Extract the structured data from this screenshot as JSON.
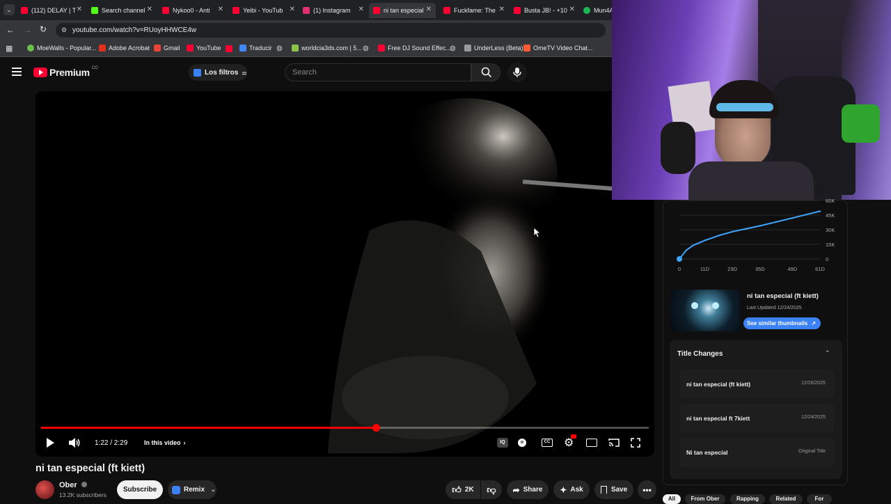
{
  "tabs": [
    {
      "label": "(112) DELAY | T",
      "color": "#ff0033"
    },
    {
      "label": "Search channel",
      "color": "#53fc18"
    },
    {
      "label": "Nykoo0 - Anti",
      "color": "#ff0033"
    },
    {
      "label": "Yeibi - YouTub",
      "color": "#ff0033"
    },
    {
      "label": "(1) Instagram",
      "color": "#e1306c"
    },
    {
      "label": "ni tan especial",
      "color": "#ff0033"
    },
    {
      "label": "Fuckfame: The",
      "color": "#ff0033"
    },
    {
      "label": "Busta JB! - +10",
      "color": "#ff0033"
    },
    {
      "label": "Mun4A",
      "color": "#1db954"
    }
  ],
  "address": {
    "url": "youtube.com/watch?v=RUoyHHWCE4w"
  },
  "bookmarks": [
    {
      "label": "MoeWalls - Popular...",
      "color": "#6abf4b"
    },
    {
      "label": "Adobe Acrobat",
      "color": "#e0301e"
    },
    {
      "label": "Gmail",
      "color": "#ea4335"
    },
    {
      "label": "YouTube",
      "color": "#ff0033"
    },
    {
      "label": "Traducir",
      "color": "#4285f4"
    },
    {
      "label": "worldcia3ds.com | 5...",
      "color": "#8bc34a"
    },
    {
      "label": "Free DJ Sound Effec...",
      "color": "#ff0033"
    },
    {
      "label": "UnderLess (Beta)",
      "color": "#999999"
    },
    {
      "label": "OmeTV Video Chat...",
      "color": "#ff5a36"
    }
  ],
  "yt_header": {
    "logo": "Premium",
    "country": "CO",
    "filters_label": "Los filtros",
    "search_placeholder": "Search"
  },
  "player": {
    "time": "1:22 / 2:29",
    "in_this_video": "In this video",
    "progress_fraction": 0.551
  },
  "video": {
    "title": "ni tan especial (ft kiett)",
    "channel": "Ober",
    "subscribers": "13.2K subscribers",
    "subscribe": "Subscribe",
    "remix": "Remix",
    "likes": "2K",
    "share": "Share",
    "ask": "Ask",
    "save": "Save"
  },
  "growth_chart": {
    "y_ticks": [
      "60K",
      "45K",
      "30K",
      "15K",
      "0"
    ],
    "x_ticks": [
      "0",
      "11D",
      "23D",
      "35D",
      "49D",
      "61D"
    ]
  },
  "chart_data": {
    "type": "line",
    "x": [
      0,
      3,
      6,
      11,
      17,
      23,
      29,
      35,
      42,
      49,
      55,
      61
    ],
    "series": [
      {
        "values": [
          0,
          9000,
          14000,
          19000,
          24000,
          28000,
          31000,
          34000,
          38000,
          42000,
          45500,
          49000
        ]
      }
    ],
    "x_tick_labels": [
      "0",
      "11D",
      "23D",
      "35D",
      "49D",
      "61D"
    ],
    "y_tick_labels": [
      "0",
      "15K",
      "30K",
      "45K",
      "60K"
    ],
    "ylim": [
      0,
      60000
    ],
    "xlim": [
      0,
      61
    ]
  },
  "thumb_card": {
    "title": "ni tan especial (ft kiett)",
    "updated": "Last Updated 12/24/2025",
    "button": "See similar thumbnails"
  },
  "title_changes": {
    "heading": "Title Changes",
    "rows": [
      {
        "title": "ni tan especial (ft kiett)",
        "date": "12/26/2025"
      },
      {
        "title": "ni tan especial ft 7kiett",
        "date": "12/24/2025"
      },
      {
        "title": "Ni tan especial",
        "date": "Original Title"
      }
    ]
  },
  "chips": [
    "All",
    "From Ober",
    "Rapping",
    "Related",
    "For"
  ]
}
